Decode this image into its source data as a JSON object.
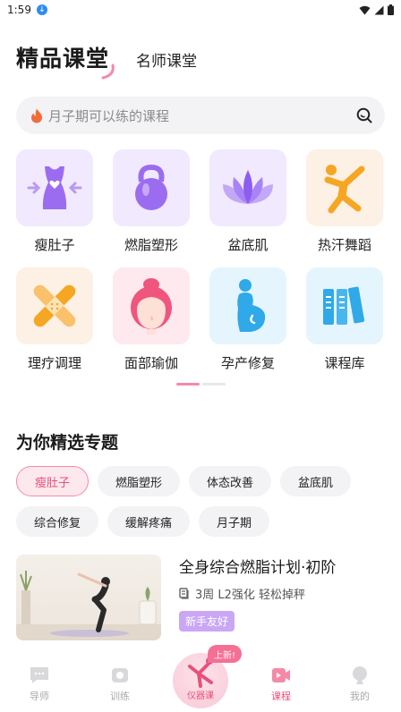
{
  "status_bar": {
    "time": "1:59",
    "download_glyph": "↓"
  },
  "tabs": {
    "active": "精品课堂",
    "secondary": "名师课堂"
  },
  "search": {
    "placeholder": "月子期可以练的课程"
  },
  "categories": [
    {
      "label": "瘦肚子",
      "icon": "waist-shape-icon"
    },
    {
      "label": "燃脂塑形",
      "icon": "kettlebell-icon"
    },
    {
      "label": "盆底肌",
      "icon": "lotus-icon"
    },
    {
      "label": "热汗舞蹈",
      "icon": "dancer-icon"
    },
    {
      "label": "理疗调理",
      "icon": "bandage-icon"
    },
    {
      "label": "面部瑜伽",
      "icon": "face-icon"
    },
    {
      "label": "孕产修复",
      "icon": "pregnant-icon"
    },
    {
      "label": "课程库",
      "icon": "books-icon"
    }
  ],
  "section": {
    "title": "为你精选专题"
  },
  "chips": {
    "row1": [
      "瘦肚子",
      "燃脂塑形",
      "体态改善",
      "盆底肌"
    ],
    "row2": [
      "综合修复",
      "缓解疼痛",
      "月子期"
    ],
    "active_index": 0
  },
  "course": {
    "title": "全身综合燃脂计划·初阶",
    "meta": "3周 L2强化 轻松掉秤",
    "badge": "新手友好"
  },
  "bottom_nav": {
    "items": [
      "导师",
      "训练",
      "仪器课",
      "课程",
      "我的"
    ],
    "active": "课程",
    "new_badge": "上新!"
  },
  "colors": {
    "accent_pink": "#f48aa8",
    "active_text": "#e8517a",
    "badge_purple": "#c9a7f5"
  }
}
